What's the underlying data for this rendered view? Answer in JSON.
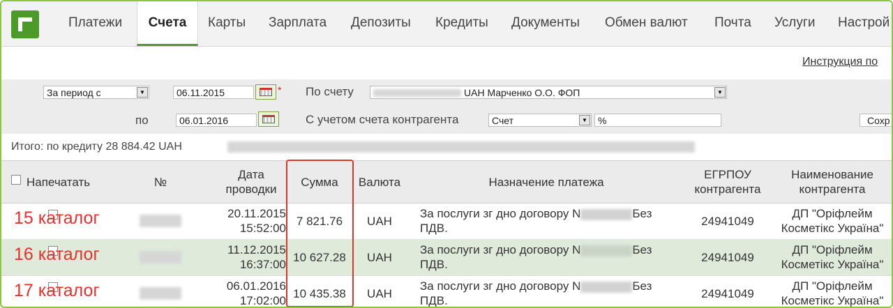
{
  "nav": {
    "items": [
      {
        "label": "Платежи"
      },
      {
        "label": "Счета",
        "active": true
      },
      {
        "label": "Карты"
      },
      {
        "label": "Зарплата"
      },
      {
        "label": "Депозиты"
      },
      {
        "label": "Кредиты"
      },
      {
        "label": "Документы"
      },
      {
        "label": "Обмен валют"
      },
      {
        "label": "Почта"
      },
      {
        "label": "Услуги"
      },
      {
        "label": "Настрой"
      }
    ]
  },
  "instruction_link": "Инструкция по",
  "filters": {
    "period_select": "За период с",
    "date_from": "06.11.2015",
    "to_label": "по",
    "date_to": "06.01.2016",
    "account_label": "По счету",
    "account_value": "UAH Марченко О.О. ФОП",
    "counter_label": "С учетом счета контрагента",
    "counter_select": "Счет",
    "counter_input": "%",
    "save_button": "Сохр"
  },
  "summary_text": "Итого: по кредиту 28 884.42 UAH",
  "table": {
    "columns": [
      "Напечатать",
      "№",
      "Дата проводки",
      "Сумма",
      "Валюта",
      "Назначение платежа",
      "ЕГРПОУ контрагента",
      "Наименование контрагента"
    ],
    "rows": [
      {
        "catalog": "15 каталог",
        "date": "20.11.2015",
        "time": "15:52:00",
        "amount": "7 821.76",
        "currency": "UAH",
        "purpose_a": "За послуги зг дно договору N",
        "purpose_b": "Без",
        "purpose_c": "ПДВ.",
        "edrpou": "24941049",
        "name_a": "ДП \"Оріфлейм",
        "name_b": "Косметікс Україна\""
      },
      {
        "catalog": "16 каталог",
        "date": "11.12.2015",
        "time": "16:37:00",
        "amount": "10 627.28",
        "currency": "UAH",
        "purpose_a": "За послуги зг дно договору N",
        "purpose_b": "Без",
        "purpose_c": "ПДВ.",
        "edrpou": "24941049",
        "name_a": "ДП \"Оріфлейм",
        "name_b": "Косметікс Україна\""
      },
      {
        "catalog": "17 каталог",
        "date": "06.01.2016",
        "time": "17:02:00",
        "amount": "10 435.38",
        "currency": "UAH",
        "purpose_a": "За послуги зг дно договору N",
        "purpose_b": "Без",
        "purpose_c": "ПДВ.",
        "edrpou": "24941049",
        "name_a": "ДП \"Оріфлейм",
        "name_b": "Косметікс Україна\""
      }
    ]
  },
  "colors": {
    "brand_green": "#4c9a2a",
    "frame_green": "#8cc63f",
    "row_highlight": "#dfeadb",
    "annotation_red": "#e5322d"
  }
}
